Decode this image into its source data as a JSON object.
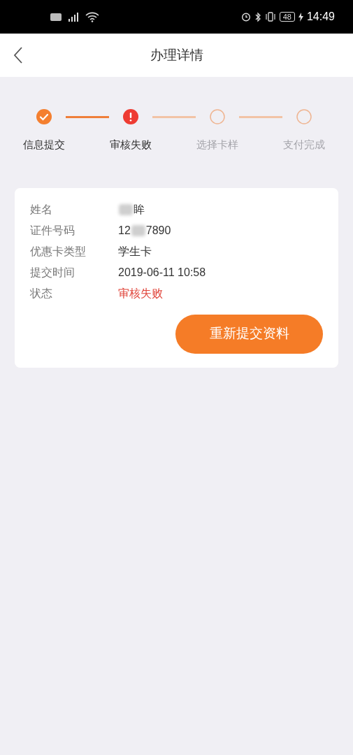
{
  "status_bar": {
    "battery": "48",
    "time": "14:49"
  },
  "header": {
    "title": "办理详情"
  },
  "steps": [
    {
      "label": "信息提交",
      "kind": "done"
    },
    {
      "label": "审核失败",
      "kind": "failed"
    },
    {
      "label": "选择卡样",
      "kind": "pending"
    },
    {
      "label": "支付完成",
      "kind": "pending"
    }
  ],
  "details": [
    {
      "label": "姓名",
      "after": "眸",
      "redacted": true,
      "kind": "normal"
    },
    {
      "label": "证件号码",
      "before": "12",
      "after": "7890",
      "redacted": true,
      "kind": "normal"
    },
    {
      "label": "优惠卡类型",
      "after": "学生卡",
      "redacted": false,
      "kind": "normal"
    },
    {
      "label": "提交时间",
      "after": "2019-06-11 10:58",
      "redacted": false,
      "kind": "normal"
    },
    {
      "label": "状态",
      "after": "审核失败",
      "redacted": false,
      "kind": "error"
    }
  ],
  "action": {
    "label": "重新提交资料"
  }
}
